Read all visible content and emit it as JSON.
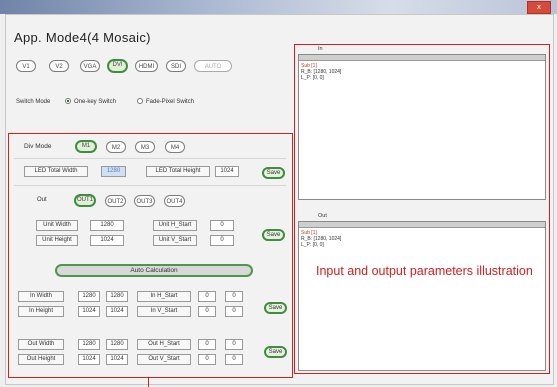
{
  "window": {
    "title": "App. Mode4(4 Mosaic)",
    "close_label": "x"
  },
  "inputs": [
    {
      "label": "V1",
      "state": "normal"
    },
    {
      "label": "V2",
      "state": "normal"
    },
    {
      "label": "VGA",
      "state": "normal"
    },
    {
      "label": "DVI",
      "state": "selected"
    },
    {
      "label": "HDMI",
      "state": "normal"
    },
    {
      "label": "SDI",
      "state": "normal"
    },
    {
      "label": "AUTO",
      "state": "disabled"
    }
  ],
  "switch_mode": {
    "label": "Switch Mode",
    "options": [
      {
        "label": "One-key Switch",
        "checked": true
      },
      {
        "label": "Fade-Pixel Switch",
        "checked": false
      }
    ]
  },
  "div_mode": {
    "label": "Div Mode",
    "buttons": [
      {
        "label": "M1",
        "state": "selected"
      },
      {
        "label": "M2",
        "state": "normal"
      },
      {
        "label": "M3",
        "state": "normal"
      },
      {
        "label": "M4",
        "state": "normal"
      }
    ]
  },
  "led_total": {
    "width_label": "LED Total Width",
    "width_value": "1280",
    "height_label": "LED Total Height",
    "height_value": "1024",
    "save_label": "Save"
  },
  "out": {
    "label": "Out",
    "buttons": [
      {
        "label": "OUT1",
        "state": "selected"
      },
      {
        "label": "OUT2",
        "state": "normal"
      },
      {
        "label": "OUT3",
        "state": "normal"
      },
      {
        "label": "OUT4",
        "state": "normal"
      }
    ]
  },
  "unit": {
    "width_label": "Unit Width",
    "width_value": "1280",
    "height_label": "Unit Height",
    "height_value": "1024",
    "hstart_label": "Unit H_Start",
    "hstart_value": "0",
    "vstart_label": "Unit V_Start",
    "vstart_value": "0",
    "save_label": "Save"
  },
  "auto_calc_label": "Auto Calculation",
  "input_params": {
    "width_label": "In Width",
    "width_a": "1280",
    "width_b": "1280",
    "height_label": "In Height",
    "height_a": "1024",
    "height_b": "1024",
    "hstart_label": "In H_Start",
    "hstart_a": "0",
    "hstart_b": "0",
    "vstart_label": "In V_Start",
    "vstart_a": "0",
    "vstart_b": "0",
    "save_label": "Save"
  },
  "output_params": {
    "width_label": "Out Width",
    "width_a": "1280",
    "width_b": "1280",
    "height_label": "Out Height",
    "height_a": "1024",
    "height_b": "1024",
    "hstart_label": "Out H_Start",
    "hstart_a": "0",
    "hstart_b": "0",
    "vstart_label": "Out V_Start",
    "vstart_a": "0",
    "vstart_b": "0",
    "save_label": "Save"
  },
  "in_panel": {
    "heading": "In",
    "rows": [
      "Sub [1]",
      "R_B: [1280, 1024]",
      "L_P: [0, 0]"
    ]
  },
  "out_panel": {
    "heading": "Out",
    "rows": [
      "Sub [1]",
      "R_B: [1280, 1024]",
      "L_P: [0, 0]"
    ]
  },
  "annotation": "Input and output parameters illustration"
}
